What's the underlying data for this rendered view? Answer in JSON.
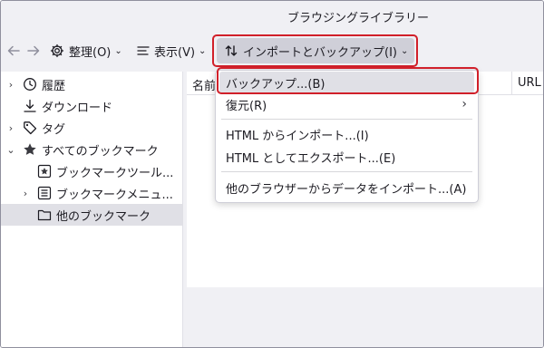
{
  "window": {
    "title": "ブラウジングライブラリー"
  },
  "toolbar": {
    "back_icon": "arrow-left-icon",
    "forward_icon": "arrow-right-icon",
    "organize_label": "整理(O)",
    "organize_icon": "gear-icon",
    "views_label": "表示(V)",
    "views_icon": "list-icon",
    "import_label": "インポートとバックアップ(I)",
    "import_icon": "sort-arrows-icon",
    "highlight_color": "#d1202a"
  },
  "sidebar": {
    "items": [
      {
        "label": "履歴",
        "icon": "clock-icon",
        "twisty": "›"
      },
      {
        "label": "ダウンロード",
        "icon": "download-icon",
        "twisty": ""
      },
      {
        "label": "タグ",
        "icon": "tag-icon",
        "twisty": "›"
      },
      {
        "label": "すべてのブックマーク",
        "icon": "star-icon",
        "twisty": "⌄"
      },
      {
        "label": "ブックマークツール...",
        "icon": "star-box-icon",
        "twisty": ""
      },
      {
        "label": "ブックマークメニュ...",
        "icon": "menu-list-icon",
        "twisty": "›"
      },
      {
        "label": "他のブックマーク",
        "icon": "folder-icon",
        "twisty": "",
        "selected": true
      }
    ]
  },
  "table": {
    "columns": [
      "名前",
      "URL"
    ]
  },
  "menu": {
    "items": [
      {
        "label": "バックアップ...(B)",
        "hover": true
      },
      {
        "label": "復元(R)",
        "submenu": "›"
      },
      {
        "label": "HTML からインポート...(I)"
      },
      {
        "label": "HTML としてエクスポート...(E)"
      },
      {
        "label": "他のブラウザーからデータをインポート...(A)"
      }
    ]
  }
}
